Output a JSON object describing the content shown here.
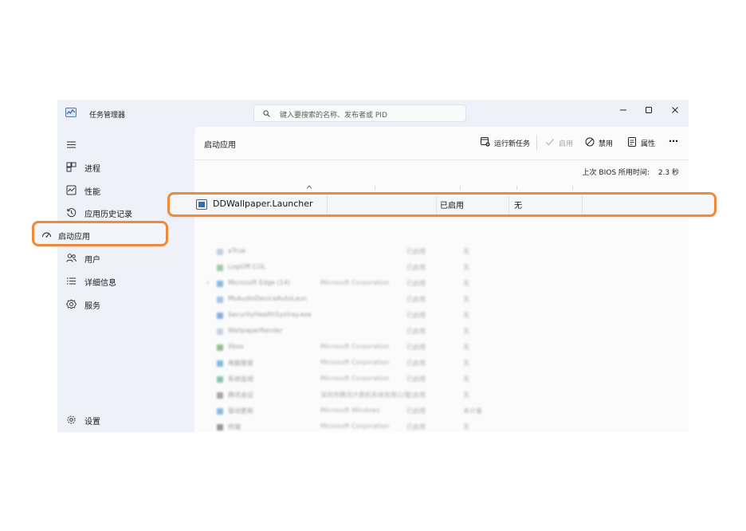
{
  "window": {
    "title": "任务管理器",
    "search_placeholder": "键入要搜索的名称、发布者或 PID"
  },
  "sidebar": {
    "items": [
      {
        "label": "进程",
        "icon": "processes-icon"
      },
      {
        "label": "性能",
        "icon": "performance-icon"
      },
      {
        "label": "应用历史记录",
        "icon": "history-icon"
      },
      {
        "label": "启动应用",
        "icon": "startup-icon",
        "active": true
      },
      {
        "label": "用户",
        "icon": "users-icon"
      },
      {
        "label": "详细信息",
        "icon": "details-icon"
      },
      {
        "label": "服务",
        "icon": "services-icon"
      }
    ],
    "settings_label": "设置"
  },
  "main": {
    "title": "启动应用",
    "toolbar": {
      "run_new_task": "运行新任务",
      "enable": "启用",
      "disable": "禁用",
      "properties": "属性",
      "more": "⋯"
    },
    "bios_label": "上次 BIOS 所用时间:",
    "bios_value": "2.3 秒"
  },
  "highlighted_row": {
    "name": "DDWallpaper.Launcher",
    "status": "已启用",
    "impact": "无"
  },
  "blurred_rows": [
    {
      "name": "aTrue",
      "publisher": "",
      "status": "已启用",
      "impact": "无",
      "color": "#9ab3c9"
    },
    {
      "name": "LogiOff.COL",
      "publisher": "",
      "status": "已启用",
      "impact": "无",
      "color": "#5fae6a"
    },
    {
      "name": "Microsoft Edge (14)",
      "publisher": "Microsoft Corporation",
      "status": "已启用",
      "impact": "无",
      "color": "#3b8fd6",
      "expandable": true
    },
    {
      "name": "MsAudioDeviceAutoLaun",
      "publisher": "",
      "status": "已启用",
      "impact": "无",
      "color": "#6a9fd6"
    },
    {
      "name": "SecurityHealthSystray.exe",
      "publisher": "",
      "status": "已启用",
      "impact": "无",
      "color": "#3a7fc8"
    },
    {
      "name": "WallpaperRender",
      "publisher": "",
      "status": "已启用",
      "impact": "无",
      "color": "#a5b5c8"
    },
    {
      "name": "Xbox",
      "publisher": "Microsoft Corporation",
      "status": "已启用",
      "impact": "无",
      "color": "#4e9a3e"
    },
    {
      "name": "电脑管家",
      "publisher": "Microsoft Corporation",
      "status": "已启用",
      "impact": "无",
      "color": "#2f8fcf"
    },
    {
      "name": "系统监视",
      "publisher": "Microsoft Corporation",
      "status": "已启用",
      "impact": "无",
      "color": "#3aa07a"
    },
    {
      "name": "腾讯会议",
      "publisher": "深圳市腾讯计算机系统有限公司",
      "status": "已启用",
      "impact": "无",
      "color": "#707070"
    },
    {
      "name": "驱动更新",
      "publisher": "Microsoft Windows",
      "status": "已启用",
      "impact": "未计量",
      "color": "#3b8fd6"
    },
    {
      "name": "终端",
      "publisher": "Microsoft Corporation",
      "status": "已启用",
      "impact": "无",
      "color": "#555555"
    }
  ],
  "colors": {
    "highlight": "#ee8a3a",
    "sidebar_bg": "#eef2f8",
    "main_bg": "#fbfbfc"
  }
}
